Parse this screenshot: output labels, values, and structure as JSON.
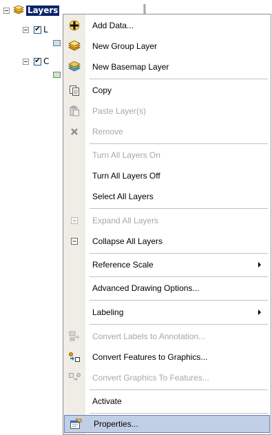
{
  "toc": {
    "root_label": "Layers",
    "layer1_label": "L",
    "layer2_label": "C",
    "colors": {
      "selection": "#0a246a",
      "swatch1": "#c8dff0",
      "swatch2": "#c9ebc2"
    }
  },
  "menu": {
    "items": [
      {
        "label": "Add Data...",
        "icon": "add-data-icon",
        "enabled": true
      },
      {
        "label": "New Group Layer",
        "icon": "group-layer-icon",
        "enabled": true
      },
      {
        "label": "New Basemap Layer",
        "icon": "basemap-layer-icon",
        "enabled": true
      },
      {
        "label": "Copy",
        "icon": "copy-icon",
        "enabled": true
      },
      {
        "label": "Paste Layer(s)",
        "icon": "paste-icon",
        "enabled": false
      },
      {
        "label": "Remove",
        "icon": "remove-icon",
        "enabled": false
      },
      {
        "label": "Turn All Layers On",
        "icon": "",
        "enabled": false
      },
      {
        "label": "Turn All Layers Off",
        "icon": "",
        "enabled": true
      },
      {
        "label": "Select All Layers",
        "icon": "",
        "enabled": true
      },
      {
        "label": "Expand All Layers",
        "icon": "expand-icon",
        "enabled": false
      },
      {
        "label": "Collapse All Layers",
        "icon": "collapse-icon",
        "enabled": true
      },
      {
        "label": "Reference Scale",
        "icon": "",
        "enabled": true,
        "submenu": true
      },
      {
        "label": "Advanced Drawing Options...",
        "icon": "",
        "enabled": true
      },
      {
        "label": "Labeling",
        "icon": "",
        "enabled": true,
        "submenu": true
      },
      {
        "label": "Convert Labels to Annotation...",
        "icon": "convert-labels-icon",
        "enabled": false
      },
      {
        "label": "Convert Features to Graphics...",
        "icon": "convert-features-icon",
        "enabled": true
      },
      {
        "label": "Convert Graphics To Features...",
        "icon": "convert-graphics-icon",
        "enabled": false
      },
      {
        "label": "Activate",
        "icon": "",
        "enabled": true
      },
      {
        "label": "Properties...",
        "icon": "properties-icon",
        "enabled": true,
        "selected": true
      }
    ],
    "colors": {
      "gutter": "#efede5",
      "highlight": "#c1cfe6",
      "disabled_text": "#a7a6aa"
    }
  }
}
